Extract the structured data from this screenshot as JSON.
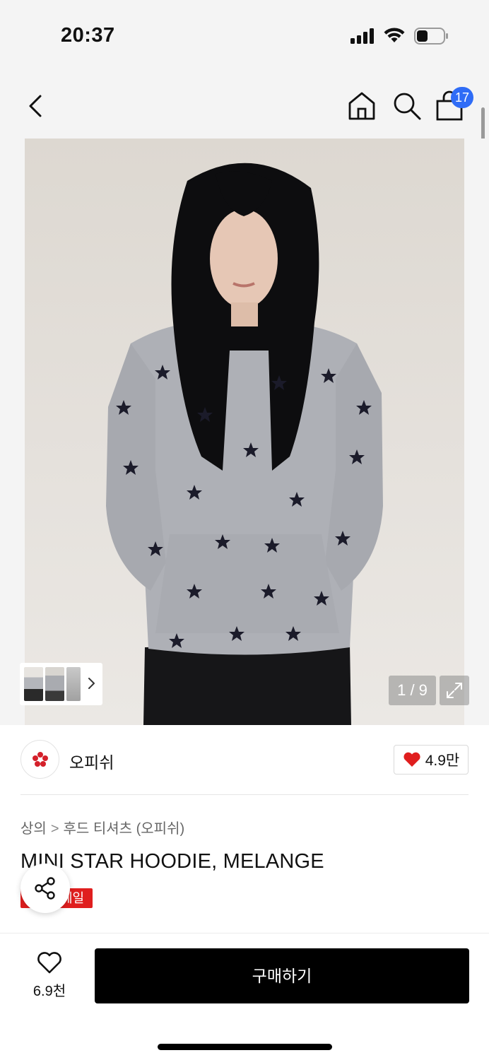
{
  "status_bar": {
    "time": "20:37"
  },
  "nav": {
    "back_icon": "chevron-left-icon",
    "home_icon": "home-icon",
    "search_icon": "search-icon",
    "cart_icon": "shopping-bag-icon",
    "cart_count": "17",
    "badge_color": "#2f6cf6"
  },
  "gallery": {
    "pager": "1 / 9",
    "expand_icon": "expand-icon",
    "thumb_chevron_icon": "chevron-right-icon"
  },
  "brand": {
    "name": "오피쉬",
    "logo_icon": "brand-flower-icon",
    "like_icon": "heart-icon",
    "like_count": "4.9만",
    "like_color": "#e01e1e"
  },
  "product": {
    "breadcrumb": [
      "상의",
      "후드 티셔츠 (오피쉬)"
    ],
    "title": "MINI STAR HOODIE, MELANGE",
    "sale_badge": "세일",
    "sale_color": "#e01e1e",
    "share_icon": "share-icon"
  },
  "bottom_bar": {
    "wish_icon": "heart-outline-icon",
    "wish_count": "6.9천",
    "buy_label": "구매하기"
  }
}
